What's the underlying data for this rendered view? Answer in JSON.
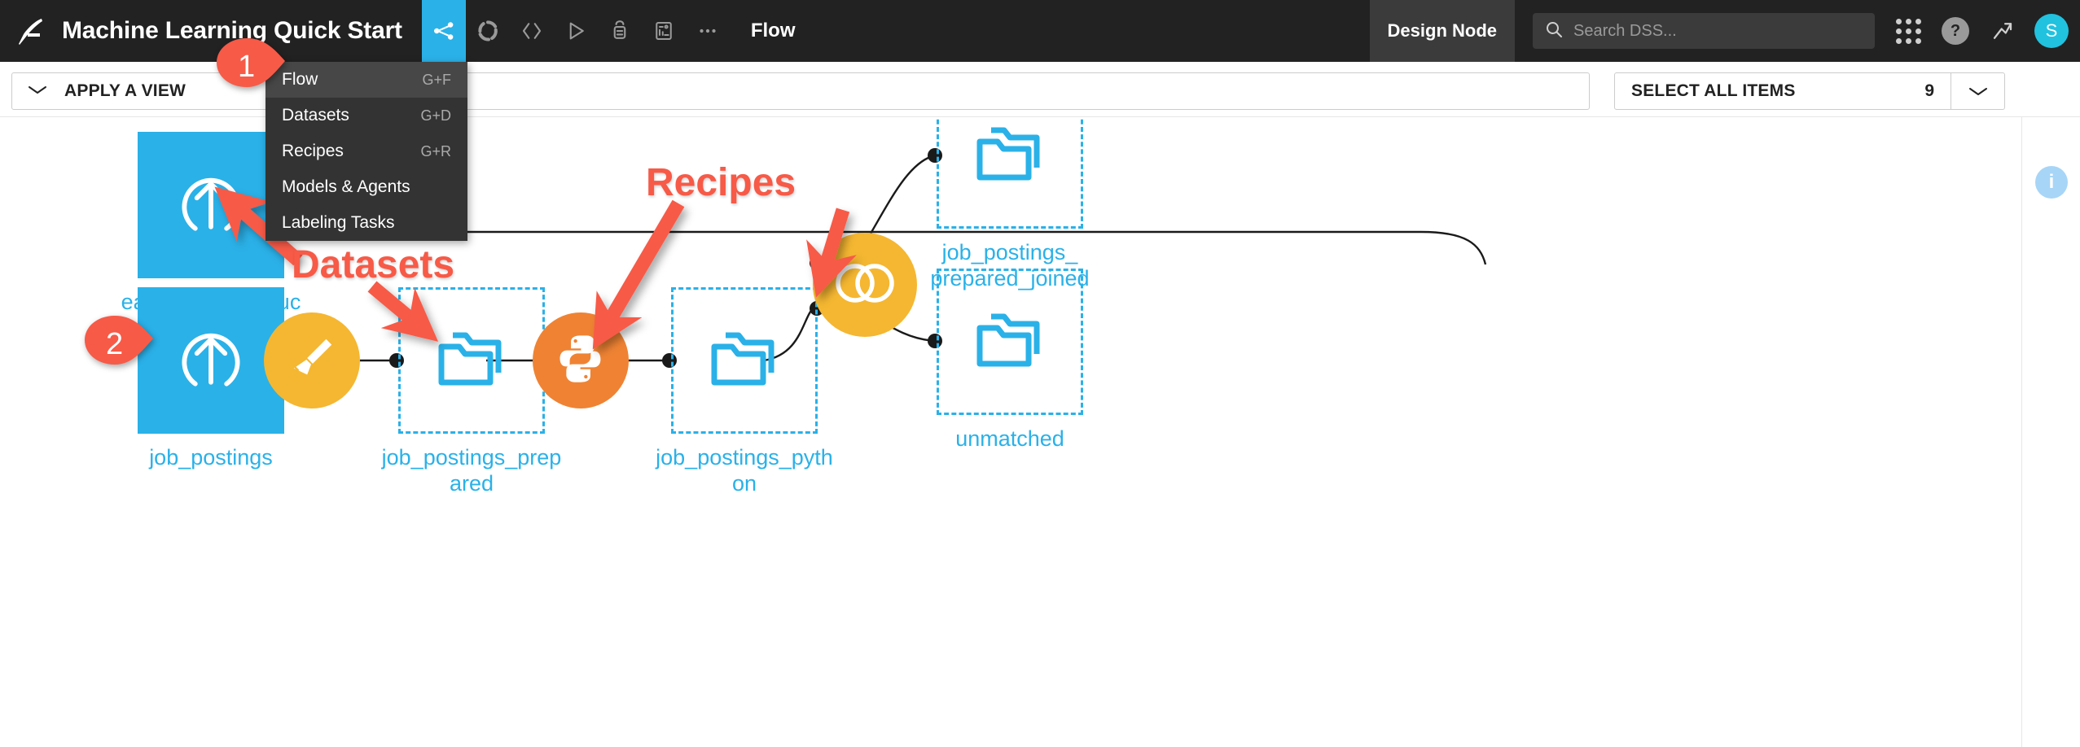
{
  "header": {
    "logo_icon": "dataiku-logo-icon",
    "project_title": "Machine Learning Quick Start",
    "nav_icons": [
      {
        "name": "flow-icon",
        "active": true
      },
      {
        "name": "lab-icon",
        "active": false
      },
      {
        "name": "code-icon",
        "active": false
      },
      {
        "name": "jobs-play-icon",
        "active": false
      },
      {
        "name": "automation-icon",
        "active": false
      },
      {
        "name": "dashboard-icon",
        "active": false
      },
      {
        "name": "more-options-icon",
        "active": false
      }
    ],
    "section_label": "Flow",
    "node_badge": "Design Node",
    "search_placeholder": "Search DSS...",
    "search_value": "",
    "apps_icon": "apps-grid-icon",
    "help_icon": "help-icon",
    "trend_icon": "trend-arrow-icon",
    "avatar_initial": "S"
  },
  "menu": {
    "items": [
      {
        "label": "Flow",
        "shortcut": "G+F",
        "selected": true
      },
      {
        "label": "Datasets",
        "shortcut": "G+D",
        "selected": false
      },
      {
        "label": "Recipes",
        "shortcut": "G+R",
        "selected": false
      },
      {
        "label": "Models & Agents",
        "shortcut": "",
        "selected": false
      },
      {
        "label": "Labeling Tasks",
        "shortcut": "",
        "selected": false
      }
    ]
  },
  "toolbar": {
    "apply_view_label": "APPLY A VIEW",
    "select_all_label": "SELECT ALL ITEMS",
    "select_all_count": "9"
  },
  "rail": {
    "back_icon": "back-arrow-icon",
    "info_icon": "info-icon",
    "info_glyph": "i"
  },
  "flow": {
    "nodes": [
      {
        "id": "earnings_by_education",
        "label": "earnings_by_education",
        "kind": "dataset-uploaded",
        "icon": "upload-dataset-icon",
        "style": "solid",
        "color": "#2ab1e8"
      },
      {
        "id": "job_postings",
        "label": "job_postings",
        "kind": "dataset-uploaded",
        "icon": "upload-dataset-icon",
        "style": "solid",
        "color": "#2ab1e8"
      },
      {
        "id": "job_postings_prepared",
        "label": "job_postings_prepared",
        "kind": "dataset-managed",
        "icon": "folder-dataset-icon",
        "style": "dashed",
        "color": "#2ab1e8"
      },
      {
        "id": "job_postings_python",
        "label": "job_postings_python",
        "kind": "dataset-managed",
        "icon": "folder-dataset-icon",
        "style": "dashed",
        "color": "#2ab1e8"
      },
      {
        "id": "job_postings_prepared_joined",
        "label": "job_postings_\nprepared_joined",
        "kind": "dataset-managed",
        "icon": "folder-dataset-icon",
        "style": "dashed",
        "color": "#2ab1e8"
      },
      {
        "id": "unmatched",
        "label": "unmatched",
        "kind": "dataset-managed",
        "icon": "folder-dataset-icon",
        "style": "dashed",
        "color": "#2ab1e8"
      }
    ],
    "recipes": [
      {
        "id": "prepare_recipe",
        "icon": "broom-prepare-icon",
        "color": "#f5b731"
      },
      {
        "id": "python_recipe",
        "icon": "python-icon",
        "color": "#ef8333"
      },
      {
        "id": "join_recipe",
        "icon": "join-venn-icon",
        "color": "#f5b731"
      }
    ]
  },
  "annotations": {
    "labels": [
      {
        "text": "Datasets",
        "color": "#f75a47"
      },
      {
        "text": "Recipes",
        "color": "#f75a47"
      }
    ],
    "markers": [
      {
        "number": "1",
        "color": "#f75a47"
      },
      {
        "number": "2",
        "color": "#f75a47"
      }
    ]
  }
}
